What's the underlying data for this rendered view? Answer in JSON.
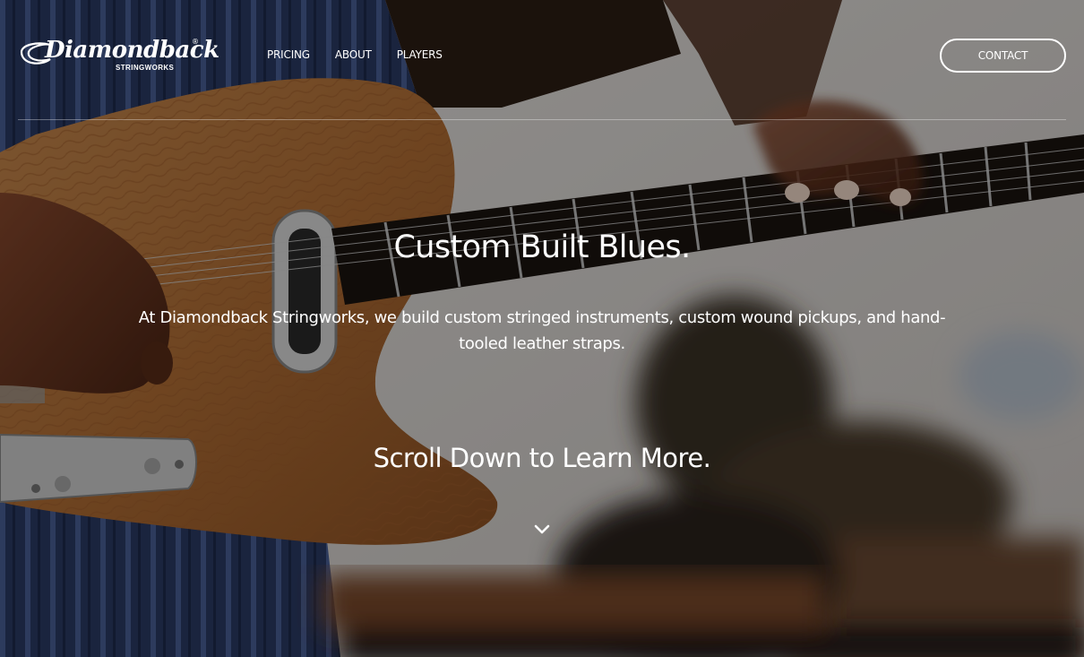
{
  "brand": {
    "name": "Diamondback",
    "registered_mark": "®",
    "subtitle": "STRINGWORKS"
  },
  "nav": {
    "links": [
      "PRICING",
      "ABOUT",
      "PLAYERS"
    ],
    "contact_label": "CONTACT"
  },
  "hero": {
    "headline": "Custom Built Blues.",
    "intro": "At Diamondback Stringworks, we build custom stringed instruments, custom wound pickups, and hand-tooled leather straps.",
    "scroll_prompt": "Scroll Down to Learn More.",
    "scroll_icon": "chevron-down-icon"
  },
  "colors": {
    "text": "#ffffff",
    "overlay": "rgba(0,0,0,0.38)",
    "guitar_wood": "#b0703a",
    "background_light": "#d8d4d0"
  }
}
